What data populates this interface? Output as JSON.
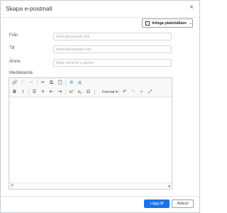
{
  "dialog": {
    "title": "Skapa e-postmall",
    "close_icon": "×"
  },
  "insert_placeholder": {
    "label": "Infoga platshållare",
    "icon": "placeholder-box-icon"
  },
  "fields": {
    "from": {
      "label": "Från",
      "placeholder": "namn@example.com"
    },
    "to": {
      "label": "Till",
      "placeholder": "adress@example.com"
    },
    "subject": {
      "label": "Ämne",
      "placeholder": "Ange ämne för e-posten"
    }
  },
  "message": {
    "label": "Meddelande"
  },
  "toolbar": {
    "format_label": "Format",
    "status_path": "P"
  },
  "buttons": {
    "primary": "Lägg till",
    "cancel": "Avbryt"
  },
  "colors": {
    "primary": "#1a73e8",
    "accent": "#2d8fd5"
  }
}
